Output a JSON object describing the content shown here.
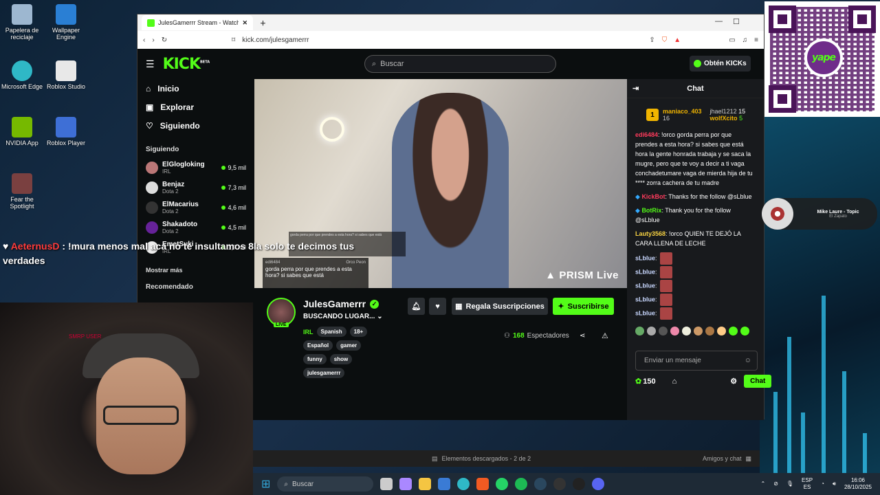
{
  "desktop": {
    "icons": [
      {
        "label": "Papelera de reciclaje",
        "color": "#9db7d0"
      },
      {
        "label": "Wallpaper Engine",
        "color": "#2a7fd4"
      },
      {
        "label": "Microsoft Edge",
        "color": "#2fb8c6"
      },
      {
        "label": "Roblox Studio",
        "color": "#e8e8e8"
      },
      {
        "label": "NVIDIA App",
        "color": "#76b900"
      },
      {
        "label": "Roblox Player",
        "color": "#3e6fd6"
      },
      {
        "label": "Fear the Spotlight",
        "color": "#7a4040"
      }
    ],
    "qr_brand": "yape"
  },
  "browser": {
    "tab_title": "JulesGamerrr Stream - Watch",
    "url": "kick.com/julesgamerrr"
  },
  "kick": {
    "logo": "KICK",
    "logo_badge": "BETA",
    "search_placeholder": "Buscar",
    "kicks_button": "Obtén KICKs",
    "nav": [
      {
        "label": "Inicio",
        "icon": "home-icon"
      },
      {
        "label": "Explorar",
        "icon": "compass-icon"
      },
      {
        "label": "Siguiendo",
        "icon": "heart-icon"
      }
    ],
    "following_title": "Siguiendo",
    "following": [
      {
        "name": "ElGlogloking",
        "category": "IRL",
        "viewers": "9,5 mil"
      },
      {
        "name": "Benjaz",
        "category": "Dota 2",
        "viewers": "7,3 mil"
      },
      {
        "name": "ElMacarius",
        "category": "Dota 2",
        "viewers": "4,6 mil"
      },
      {
        "name": "Shakadoto",
        "category": "Dota 2",
        "viewers": "4,5 mil"
      },
      {
        "name": "EmetSuki",
        "category": "IRL",
        "viewers": "1,7 mil"
      }
    ],
    "show_more": "Mostrar más",
    "recommended_title": "Recomendado",
    "video": {
      "prism": "PRISM Live",
      "overlay_user": "edi6484",
      "overlay_user2": "Orco Peon",
      "overlay_text": "gorda perra por que prendes a esta hora? si sabes que está"
    },
    "stream": {
      "name": "JulesGamerrr",
      "live": "LIVE",
      "title": "BUSCANDO LUGAR...",
      "category": "IRL",
      "tags_row1": [
        "Spanish",
        "18+"
      ],
      "tags_row2": [
        "Español",
        "gamer"
      ],
      "tags_row3": [
        "funny",
        "show"
      ],
      "tags_row4": [
        "julesgamerrr"
      ],
      "gift_subs": "Regala Suscripciones",
      "subscribe": "Suscribirse",
      "viewer_count": "168",
      "viewer_label": "Espectadores"
    },
    "chat": {
      "title": "Chat",
      "leaders": [
        {
          "rank": "1",
          "name": "maniaco_403",
          "count": "16"
        },
        {
          "name": "jhael1212",
          "count": "15"
        },
        {
          "name": "wolfXcito",
          "count": "5"
        }
      ],
      "messages": [
        {
          "user": "edi6484",
          "color": "#ff3b5c",
          "text": "!orco gorda perra por que prendes a esta hora? si sabes que está hora la gente honrada trabaja y se saca la mugre, pero que te voy a decir a ti vaga conchadetumare vaga de mierda hija de tu **** zorra cachera de tu madre"
        },
        {
          "user": "KickBot",
          "color": "#ff3b5c",
          "text": "Thanks for the follow @sLblue"
        },
        {
          "user": "BotRix",
          "color": "#53fc18",
          "text": "Thank you for the follow @sLblue"
        },
        {
          "user": "Lauty3568",
          "color": "#f5d142",
          "text": "!orco QUIEN TE DEJÓ LA CARA LLENA DE LECHE"
        },
        {
          "user": "sLblue",
          "color": "#c9d8ff",
          "text": ""
        },
        {
          "user": "sLblue",
          "color": "#c9d8ff",
          "text": ""
        },
        {
          "user": "sLblue",
          "color": "#c9d8ff",
          "text": ""
        },
        {
          "user": "sLblue",
          "color": "#c9d8ff",
          "text": ""
        },
        {
          "user": "sLblue",
          "color": "#c9d8ff",
          "text": ""
        }
      ],
      "input_placeholder": "Enviar un mensaje",
      "points": "150",
      "send": "Chat"
    }
  },
  "overlay_chat": {
    "user": "AeternusD",
    "text": "!mura menos mal aca no te insultamos 8la solo te decimos tus verdades"
  },
  "cam_label": "SMRP USER",
  "music": {
    "title": "Mike Laure - Topic",
    "subtitle": "El Zapato"
  },
  "download_bar": {
    "text": "Elementos descargados - 2 de 2",
    "friends": "Amigos y chat"
  },
  "taskbar": {
    "search": "Buscar",
    "lang": "ESP",
    "lang2": "ES",
    "time": "16:06",
    "date": "28/10/2025"
  }
}
